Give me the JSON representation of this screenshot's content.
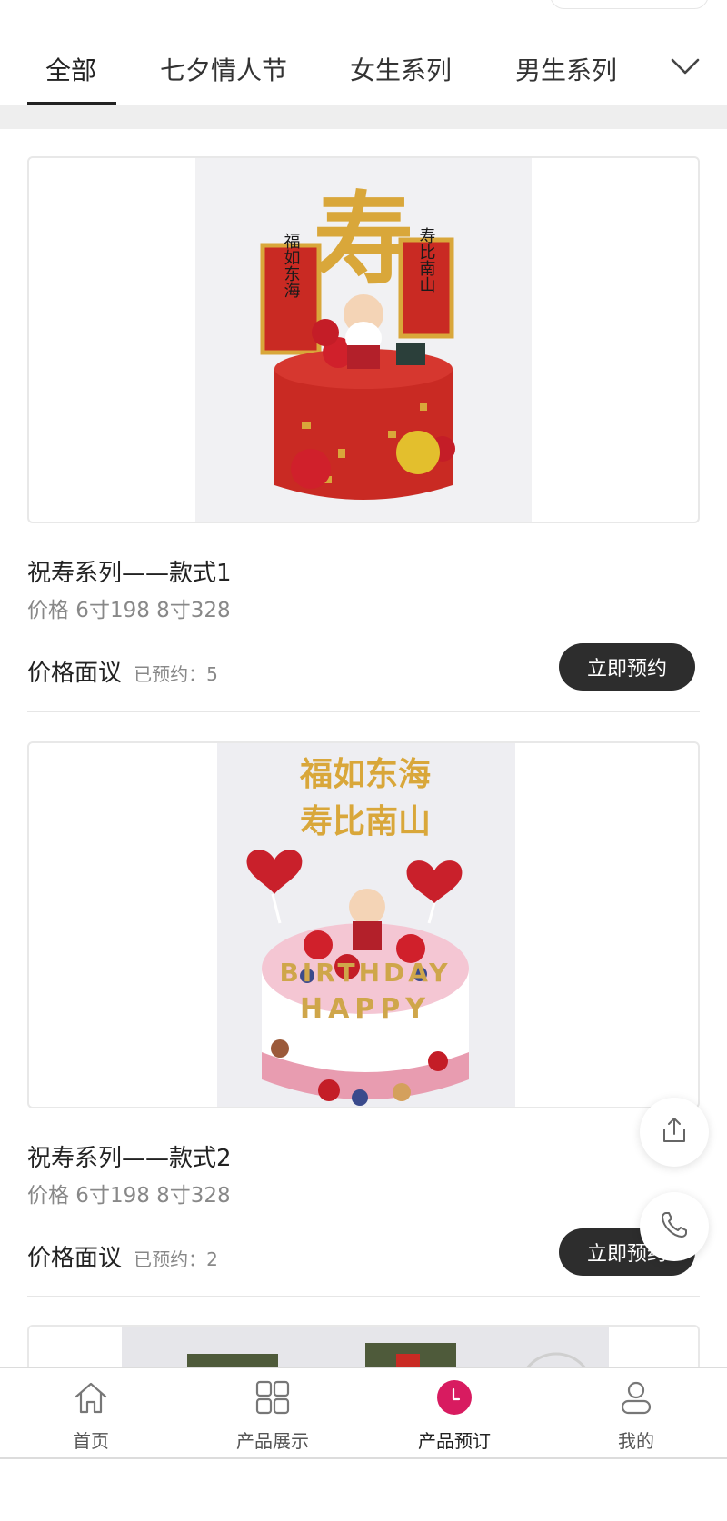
{
  "tabs": {
    "items": [
      {
        "label": "全部",
        "active": true
      },
      {
        "label": "七夕情人节",
        "active": false
      },
      {
        "label": "女生系列",
        "active": false
      },
      {
        "label": "男生系列",
        "active": false
      }
    ],
    "more_icon": "chevron-down-icon"
  },
  "products": [
    {
      "title": "祝寿系列——款式1",
      "subtitle": "价格 6寸198 8寸328",
      "price_label": "价格面议",
      "booked_text": "已预约：5",
      "button_label": "立即预约",
      "cake_topper_text": [
        "福如东海",
        "寿比南山",
        "寿"
      ]
    },
    {
      "title": "祝寿系列——款式2",
      "subtitle": "价格 6寸198 8寸328",
      "price_label": "价格面议",
      "booked_text": "已预约：2",
      "button_label": "立即预约",
      "cake_topper_text": [
        "福如东海",
        "寿比南山",
        "HAPPY",
        "BIRTHDAY"
      ]
    }
  ],
  "floating_actions": {
    "share_icon": "share-icon",
    "phone_icon": "phone-icon"
  },
  "bottom_nav": {
    "items": [
      {
        "label": "首页",
        "icon": "home-icon",
        "active": false
      },
      {
        "label": "产品展示",
        "icon": "grid-icon",
        "active": false
      },
      {
        "label": "产品预订",
        "icon": "clock-icon",
        "active": true
      },
      {
        "label": "我的",
        "icon": "user-icon",
        "active": false
      }
    ]
  },
  "colors": {
    "accent": "#d81b60",
    "button_bg": "#2d2d2d",
    "cake_red": "#c92a23",
    "gold": "#d9a73a"
  }
}
